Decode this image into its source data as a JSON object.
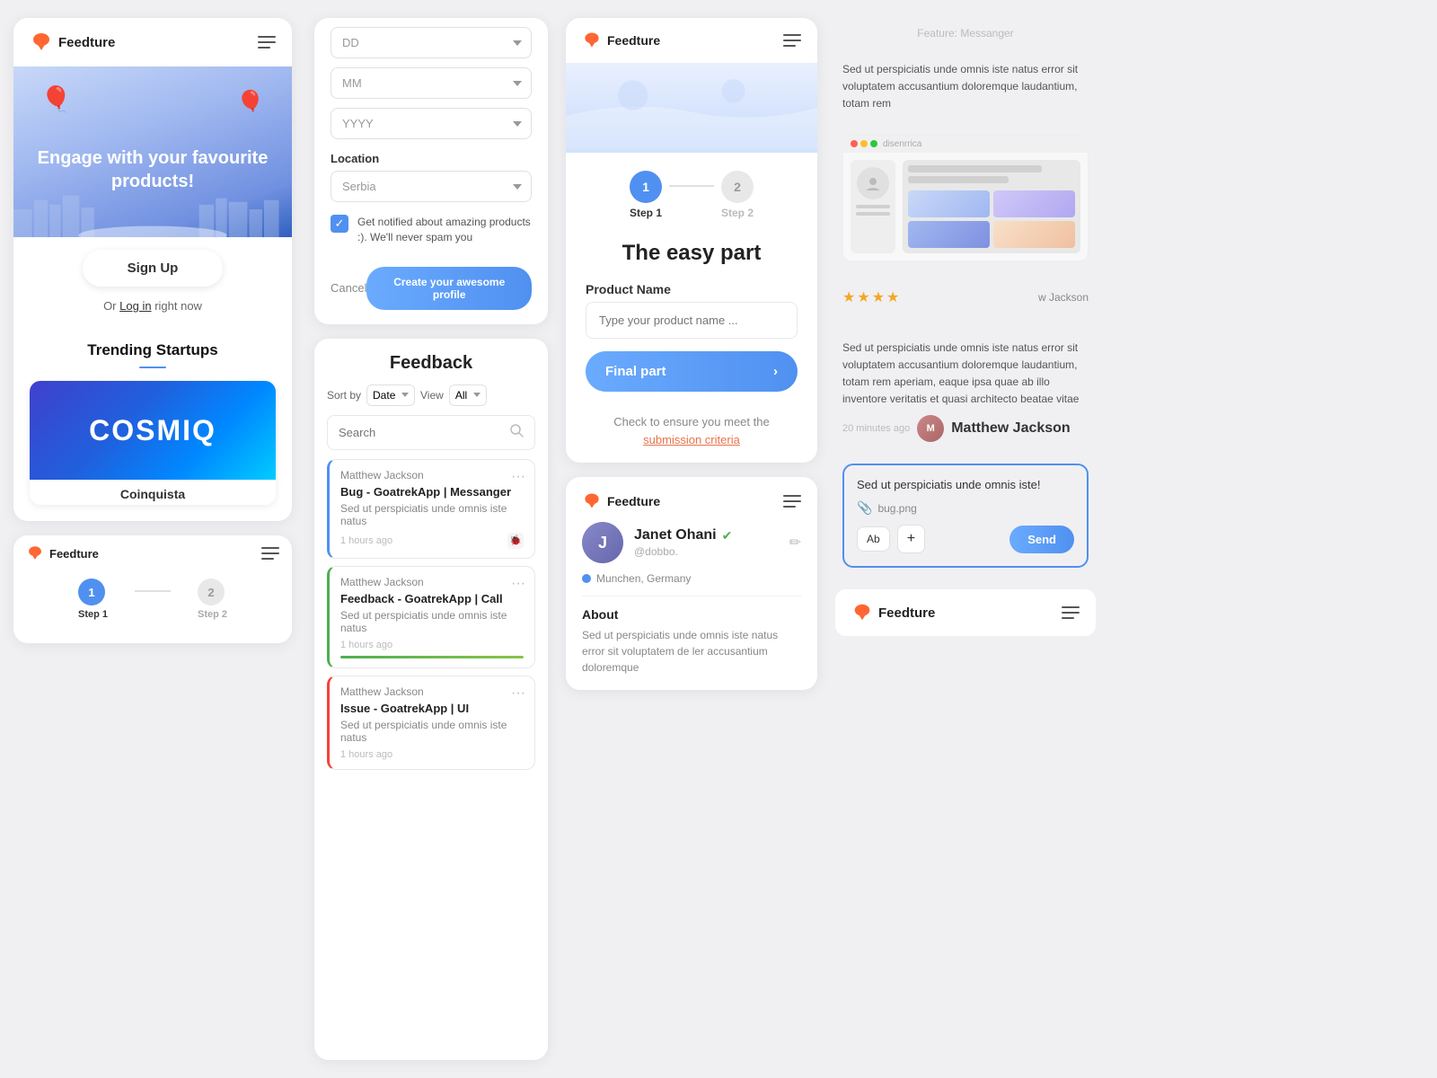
{
  "col1": {
    "card1": {
      "logo": "Feedture",
      "hero_text": "Engage with your favourite products!",
      "signup_btn": "Sign Up",
      "login_text": "Or",
      "login_link": "Log in",
      "login_suffix": "right now",
      "trending_title": "Trending Startups",
      "trending_item": {
        "name": "COSMIQ",
        "sub": "Coinquista"
      }
    },
    "card2": {
      "logo": "Feedture",
      "step1_num": "1",
      "step1_label": "Step 1",
      "step2_num": "2",
      "step2_label": "Step 2"
    }
  },
  "col2": {
    "form": {
      "dd_placeholder": "DD",
      "mm_placeholder": "MM",
      "yyyy_placeholder": "YYYY",
      "location_label": "Location",
      "location_value": "Serbia",
      "checkbox_text": "Get notified about amazing products :). We'll never spam you",
      "cancel_btn": "Cancel",
      "create_btn": "Create your awesome profile"
    },
    "feedback": {
      "title": "Feedback",
      "sort_by": "Sort by",
      "date_label": "Date",
      "view_label": "View",
      "all_label": "All",
      "search_placeholder": "Search",
      "items": [
        {
          "author": "Matthew Jackson",
          "title": "Bug - GoatrekApp | Messanger",
          "desc": "Sed ut perspiciatis unde omnis iste natus",
          "time": "1 hours ago",
          "accent": "blue"
        },
        {
          "author": "Matthew Jackson",
          "title": "Feedback - GoatrekApp | Call",
          "desc": "Sed ut perspiciatis unde omnis iste natus",
          "time": "1 hours ago",
          "accent": "green"
        },
        {
          "author": "Matthew Jackson",
          "title": "Issue - GoatrekApp | UI",
          "desc": "Sed ut perspiciatis unde omnis iste natus",
          "time": "1 hours ago",
          "accent": "red"
        }
      ]
    }
  },
  "col3": {
    "step_card": {
      "logo": "Feedture",
      "step1_num": "1",
      "step1_label": "Step 1",
      "step2_num": "2",
      "step2_label": "Step 2",
      "easy_title": "The easy part",
      "product_name_label": "Product Name",
      "product_placeholder": "Type your product name ...",
      "final_btn": "Final part",
      "submission_prefix": "Check to ensure you meet the",
      "submission_link": "submission criteria"
    },
    "profile_card": {
      "logo": "Feedture",
      "name": "Janet Ohani",
      "handle": "@dobbo.",
      "location": "Munchen, Germany",
      "about_label": "About",
      "about_text": "Sed ut perspiciatis unde omnis iste natus error sit voluptatem de ler accusantium doloremque"
    }
  },
  "col4": {
    "feature_label": "Feature: Messanger",
    "review_text": "Sed ut perspiciatis unde omnis iste natus error sit voluptatem accusantium doloremque laudantium, totam rem",
    "stars": "★★★★",
    "reviewer": "w Jackson",
    "review2_text": "Sed ut perspiciatis unde omnis iste natus error sit voluptatem accusantium doloremque laudantium, totam rem aperiam, eaque ipsa quae ab illo inventore veritatis et quasi architecto beatae vitae",
    "reviewer2_time": "20 minutes ago",
    "reviewer2_name": "Matthew Jackson",
    "message_text": "Sed ut perspiciatis unde omnis iste!",
    "attachment": "bug.png",
    "btn_ab": "Ab",
    "btn_plus": "+",
    "btn_send": "Send",
    "footer_logo": "Feedture"
  }
}
